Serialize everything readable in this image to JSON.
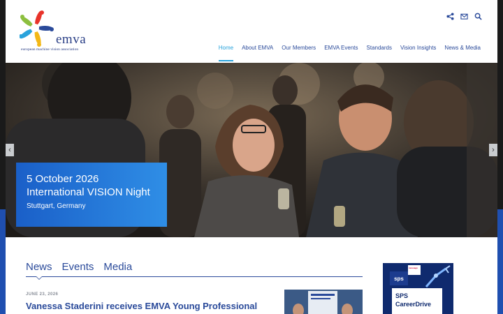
{
  "brand": {
    "name": "emva",
    "tagline": "european machine vision association"
  },
  "top_icons": [
    "share-icon",
    "mail-icon",
    "search-icon"
  ],
  "nav": {
    "items": [
      {
        "label": "Home",
        "active": true
      },
      {
        "label": "About EMVA",
        "active": false
      },
      {
        "label": "Our Members",
        "active": false
      },
      {
        "label": "EMVA Events",
        "active": false
      },
      {
        "label": "Standards",
        "active": false
      },
      {
        "label": "Vision Insights",
        "active": false
      },
      {
        "label": "News & Media",
        "active": false
      }
    ]
  },
  "hero": {
    "date": "5 October 2026",
    "title": "International VISION Night",
    "place": "Stuttgart, Germany",
    "prev_icon": "chevron-left-icon",
    "next_icon": "chevron-right-icon"
  },
  "content_tabs": [
    "News",
    "Events",
    "Media"
  ],
  "news": {
    "date": "JUNE 23, 2026",
    "title": "Vanessa Staderini receives EMVA Young Professional"
  },
  "ad": {
    "logo": "sps",
    "mini_label": "messago",
    "text_line1": "SPS",
    "text_line2": "CareerDrive"
  },
  "colors": {
    "brand_blue": "#2a4a9a",
    "accent": "#29a3dc",
    "card_start": "#1a5fc8",
    "card_end": "#2f8ee6"
  }
}
